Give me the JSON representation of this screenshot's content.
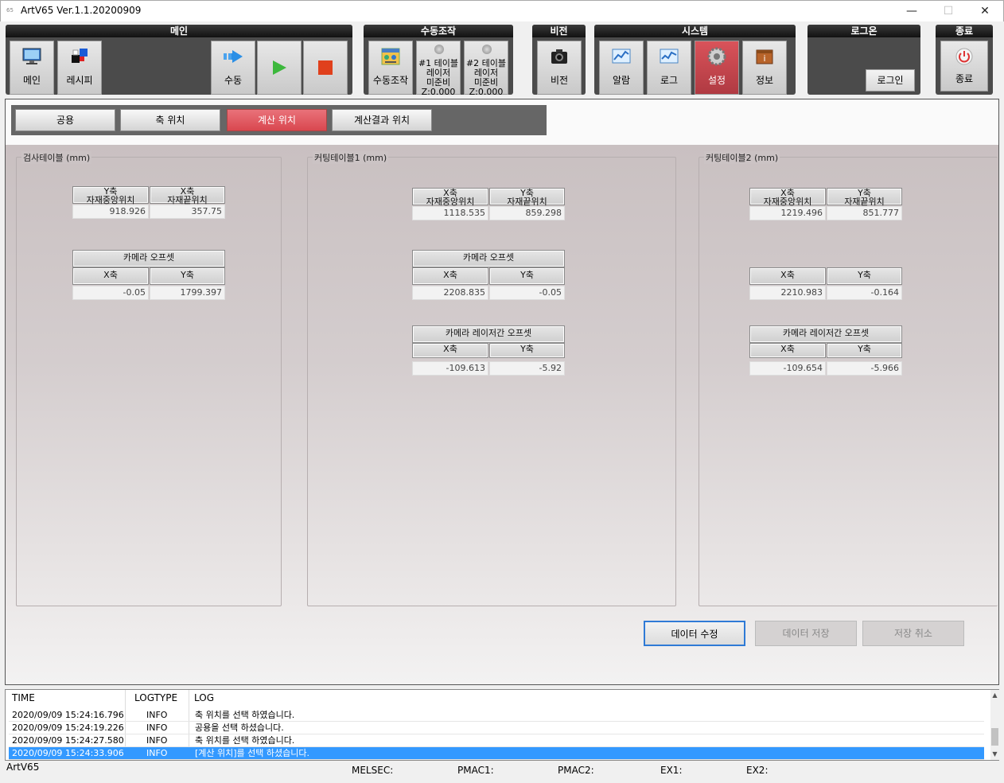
{
  "window": {
    "title": "ArtV65 Ver.1.1.20200909",
    "icon_label": "65",
    "minimize": "—",
    "maximize": "☐",
    "close": "✕"
  },
  "toolbar": {
    "main_group": {
      "title": "메인",
      "main_label": "메인",
      "recipe_label": "레시피",
      "manual_label": "수동"
    },
    "manual_group": {
      "title": "수동조작",
      "manual_op_label": "수동조작",
      "laser1": [
        "#1 테이블",
        "레이저",
        "미준비",
        "Z:0.000"
      ],
      "laser2": [
        "#2 테이블",
        "레이저",
        "미준비",
        "Z:0.000"
      ]
    },
    "vision_group": {
      "title": "비전",
      "vision_label": "비전"
    },
    "system_group": {
      "title": "시스템",
      "alarm_label": "알람",
      "log_label": "로그",
      "settings_label": "설정",
      "info_label": "정보"
    },
    "login_group": {
      "title": "로그온",
      "login_label": "로그인"
    },
    "exit_group": {
      "title": "종료",
      "exit_label": "종료"
    }
  },
  "tabs": [
    "공용",
    "축 위치",
    "계산 위치",
    "계산결과 위치"
  ],
  "active_tab": "계산 위치",
  "sections": {
    "inspect": {
      "title": "검사테이블 (mm)",
      "pos_headers": [
        [
          "Y축",
          "자재중앙위치"
        ],
        [
          "X축",
          "자재끝위치"
        ]
      ],
      "pos_values": [
        "918.926",
        "357.75"
      ],
      "cam_title": "카메라 오프셋",
      "cam_headers": [
        "X축",
        "Y축"
      ],
      "cam_values": [
        "-0.05",
        "1799.397"
      ]
    },
    "cutting1": {
      "title": "커팅테이블1 (mm)",
      "pos_headers": [
        [
          "X축",
          "자재중앙위치"
        ],
        [
          "Y축",
          "자재끝위치"
        ]
      ],
      "pos_values": [
        "1118.535",
        "859.298"
      ],
      "cam_title": "카메라 오프셋",
      "cam_headers": [
        "X축",
        "Y축"
      ],
      "cam_values": [
        "2208.835",
        "-0.05"
      ],
      "laser_title": "카메라 레이저간 오프셋",
      "laser_headers": [
        "X축",
        "Y축"
      ],
      "laser_values": [
        "-109.613",
        "-5.92"
      ]
    },
    "cutting2": {
      "title": "커팅테이블2 (mm)",
      "pos_headers": [
        [
          "X축",
          "자재중앙위치"
        ],
        [
          "Y축",
          "자재끝위치"
        ]
      ],
      "pos_values": [
        "1219.496",
        "851.777"
      ],
      "cam_headers": [
        "X축",
        "Y축"
      ],
      "cam_values": [
        "2210.983",
        "-0.164"
      ],
      "laser_title": "카메라 레이저간 오프셋",
      "laser_headers": [
        "X축",
        "Y축"
      ],
      "laser_values": [
        "-109.654",
        "-5.966"
      ]
    }
  },
  "actions": {
    "edit": "데이터 수정",
    "save": "데이터 저장",
    "cancel": "저장 취소"
  },
  "log": {
    "headers": [
      "TIME",
      "LOGTYPE",
      "LOG"
    ],
    "rows": [
      [
        "2020/09/09 15:24:16.796",
        "INFO",
        "축 위치를 선택 하였습니다."
      ],
      [
        "2020/09/09 15:24:19.226",
        "INFO",
        "공용을 선택 하셨습니다."
      ],
      [
        "2020/09/09 15:24:27.580",
        "INFO",
        "축 위치를 선택 하였습니다."
      ],
      [
        "2020/09/09 15:24:33.906",
        "INFO",
        "[계산 위치]를 선택 하셨습니다."
      ]
    ],
    "selected_row": 3
  },
  "status": {
    "app": "ArtV65",
    "melsec": "MELSEC:",
    "pmac1": "PMAC1:",
    "pmac2": "PMAC2:",
    "ex1": "EX1:",
    "ex2": "EX2:"
  },
  "colors": {
    "accent_red": "#d9474f",
    "selection_blue": "#3399ff",
    "focus_blue": "#2f7ad6"
  }
}
